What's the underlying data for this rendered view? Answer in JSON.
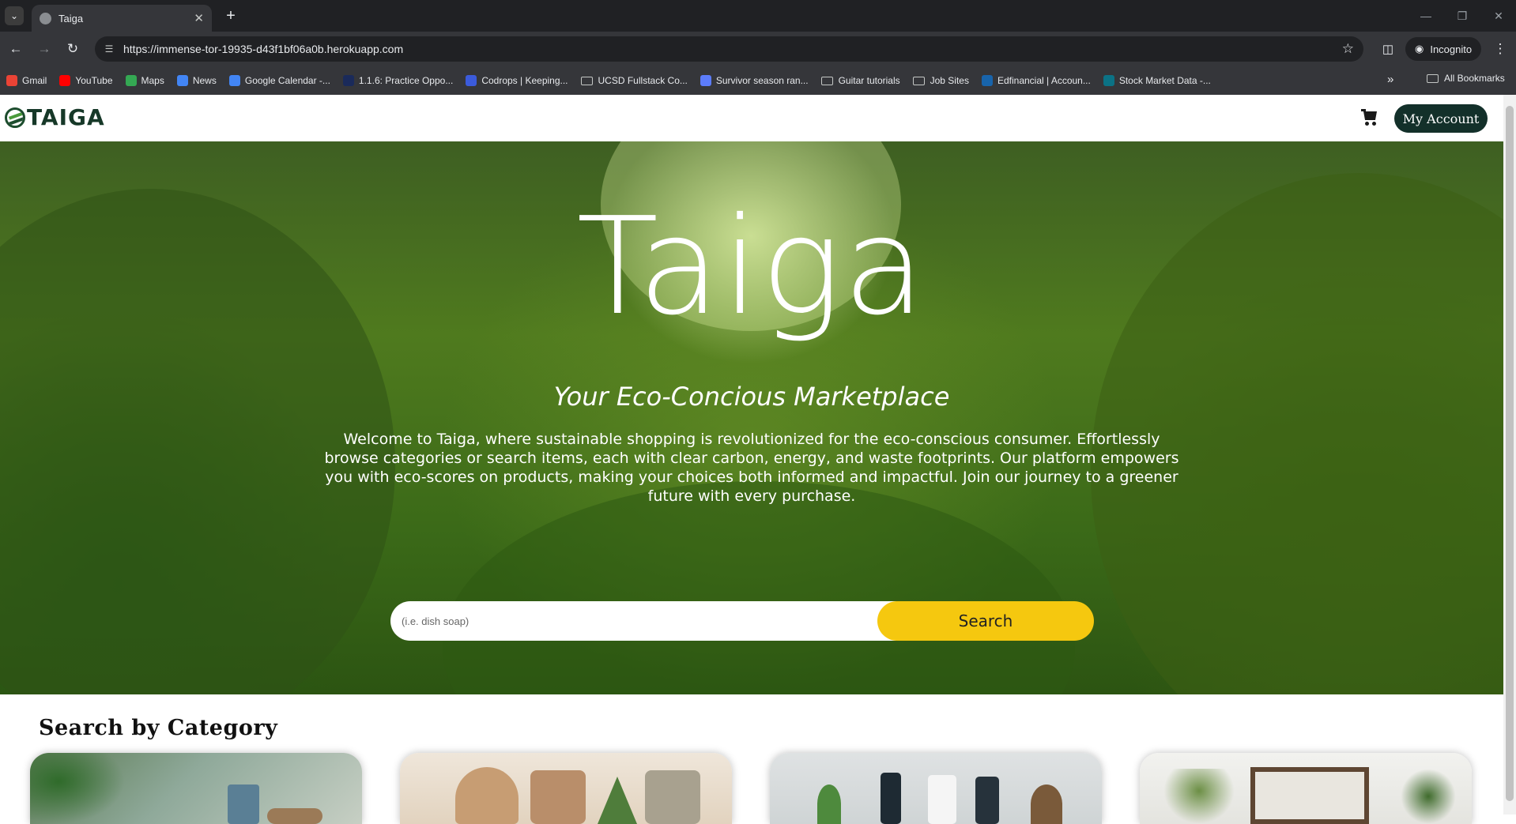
{
  "browser": {
    "tab_title": "Taiga",
    "url": "https://immense-tor-19935-d43f1bf06a0b.herokuapp.com",
    "incognito_label": "Incognito",
    "bookmarks": [
      {
        "label": "Gmail",
        "icon": "gmail-icon",
        "color": "#ea4335"
      },
      {
        "label": "YouTube",
        "icon": "youtube-icon",
        "color": "#ff0000"
      },
      {
        "label": "Maps",
        "icon": "maps-icon",
        "color": "#34a853"
      },
      {
        "label": "News",
        "icon": "news-icon",
        "color": "#4285f4"
      },
      {
        "label": "Google Calendar -...",
        "icon": "calendar-icon",
        "color": "#4285f4"
      },
      {
        "label": "1.1.6: Practice Oppo...",
        "icon": "course-icon",
        "color": "#1a2a5a"
      },
      {
        "label": "Codrops | Keeping...",
        "icon": "codrops-icon",
        "color": "#3b5bdb"
      },
      {
        "label": "UCSD Fullstack Co...",
        "icon": "folder-icon",
        "color": ""
      },
      {
        "label": "Survivor season ran...",
        "icon": "grid-icon",
        "color": "#5c7cfa"
      },
      {
        "label": "Guitar tutorials",
        "icon": "folder-icon",
        "color": ""
      },
      {
        "label": "Job Sites",
        "icon": "folder-icon",
        "color": ""
      },
      {
        "label": "Edfinancial | Accoun...",
        "icon": "edfinancial-icon",
        "color": "#1864ab"
      },
      {
        "label": "Stock Market Data -...",
        "icon": "stock-icon",
        "color": "#0b7285"
      }
    ],
    "all_bookmarks_label": "All Bookmarks"
  },
  "site": {
    "logo_text": "TAIGA",
    "account_button": "My Account",
    "hero": {
      "title": "Taiga",
      "subtitle": "Your Eco-Concious Marketplace",
      "description": "Welcome to Taiga, where sustainable shopping is revolutionized for the eco-conscious consumer. Effortlessly browse categories or search items, each with clear carbon, energy, and waste footprints. Our platform empowers you with eco-scores on products, making your choices both informed and impactful. Join our journey to a greener future with every purchase."
    },
    "search": {
      "placeholder": "(i.e. dish soap)",
      "button_label": "Search"
    },
    "categories": {
      "heading": "Search by Category"
    }
  },
  "colors": {
    "brand_dark": "#13302a",
    "search_button": "#f5c80f",
    "chrome_dark": "#202124",
    "chrome_mid": "#35363a"
  }
}
